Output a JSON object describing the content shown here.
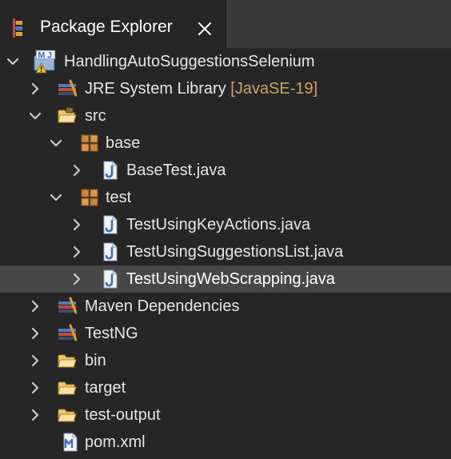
{
  "tab": {
    "title": "Package Explorer",
    "icon": "package-explorer-icon",
    "close_icon": "close-icon"
  },
  "tree": {
    "project": {
      "label": "HandlingAutoSuggestionsSelenium",
      "expanded": true,
      "icon": "maven-java-project-warning-icon"
    },
    "jre": {
      "label": "JRE System Library",
      "decoration": "[JavaSE-19]",
      "expanded": false,
      "icon": "library-icon"
    },
    "src": {
      "label": "src",
      "expanded": true,
      "icon": "source-folder-icon"
    },
    "pkg_base": {
      "label": "base",
      "expanded": true,
      "icon": "package-icon"
    },
    "file_basetest": {
      "label": "BaseTest.java",
      "expanded": false,
      "icon": "java-file-icon"
    },
    "pkg_test": {
      "label": "test",
      "expanded": true,
      "icon": "package-icon"
    },
    "file_keyactions": {
      "label": "TestUsingKeyActions.java",
      "expanded": false,
      "icon": "java-file-icon"
    },
    "file_suggestions": {
      "label": "TestUsingSuggestionsList.java",
      "expanded": false,
      "icon": "java-file-icon"
    },
    "file_webscrapping": {
      "label": "TestUsingWebScrapping.java",
      "expanded": false,
      "selected": true,
      "icon": "java-file-icon"
    },
    "maven_deps": {
      "label": "Maven Dependencies",
      "expanded": false,
      "icon": "library-icon"
    },
    "testng": {
      "label": "TestNG",
      "expanded": false,
      "icon": "library-icon"
    },
    "bin": {
      "label": "bin",
      "expanded": false,
      "icon": "folder-icon"
    },
    "target": {
      "label": "target",
      "expanded": false,
      "icon": "folder-icon"
    },
    "test_output": {
      "label": "test-output",
      "expanded": false,
      "icon": "folder-icon"
    },
    "pom": {
      "label": "pom.xml",
      "icon": "maven-pom-icon"
    }
  },
  "colors": {
    "background": "#262626",
    "tabbar": "#3a3a3a",
    "selection": "#474747",
    "decoration_text": "#c8a36a"
  }
}
